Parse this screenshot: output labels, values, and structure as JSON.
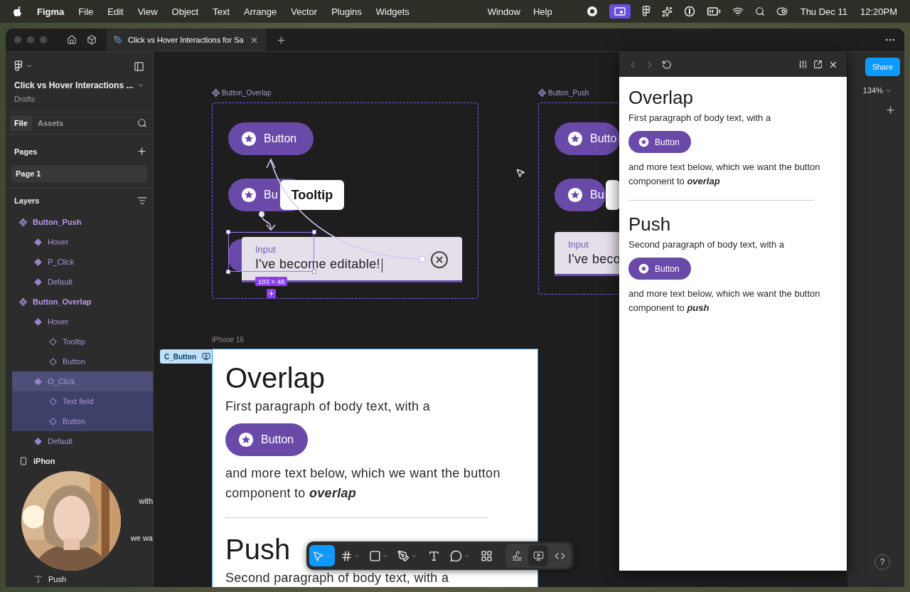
{
  "menubar": {
    "app": "Figma",
    "menus": [
      "File",
      "Edit",
      "View",
      "Object",
      "Text",
      "Arrange",
      "Vector",
      "Plugins",
      "Widgets"
    ],
    "right_menus": [
      "Window",
      "Help"
    ],
    "date": "Thu Dec 11",
    "time": "12:20PM"
  },
  "tabbar": {
    "tabs": [
      {
        "label": "Click vs Hover Interactions for Sa",
        "selected": true
      }
    ]
  },
  "sidebar": {
    "file_title": "Click vs Hover Interactions ...",
    "location": "Drafts",
    "tabs": [
      {
        "label": "File",
        "selected": true
      },
      {
        "label": "Assets",
        "selected": false
      }
    ],
    "pages_heading": "Pages",
    "pages": [
      {
        "label": "Page 1",
        "selected": true
      }
    ],
    "layers_heading": "Layers",
    "layers": [
      {
        "name": "Button_Push",
        "kind": "component",
        "selected": false,
        "children": [
          {
            "name": "Hover",
            "kind": "variant",
            "selected": false
          },
          {
            "name": "P_Click",
            "kind": "variant",
            "selected": false
          },
          {
            "name": "Default",
            "kind": "variant",
            "selected": false
          }
        ]
      },
      {
        "name": "Button_Overlap",
        "kind": "component",
        "selected": false,
        "children": [
          {
            "name": "Hover",
            "kind": "variant",
            "selected": false,
            "children": [
              {
                "name": "Tooltip",
                "kind": "instance",
                "selected": false
              },
              {
                "name": "Button",
                "kind": "instance",
                "selected": false
              }
            ]
          },
          {
            "name": "O_Click",
            "kind": "variant",
            "selected": true,
            "children": [
              {
                "name": "Text field",
                "kind": "instance",
                "selected": false
              },
              {
                "name": "Button",
                "kind": "instance",
                "selected": false
              }
            ]
          },
          {
            "name": "Default",
            "kind": "variant",
            "selected": false
          }
        ]
      },
      {
        "name": "iPhon",
        "kind": "frame",
        "selected": false,
        "children": [
          {
            "name": "with",
            "kind": "partial",
            "selected": false
          },
          {
            "name": "we wa",
            "kind": "partial",
            "selected": false
          },
          {
            "name": "Push",
            "kind": "text",
            "selected": false
          }
        ]
      }
    ]
  },
  "canvas": {
    "overlap_frame": {
      "label": "Button_Overlap",
      "button": "Button",
      "hover_button": "Bu",
      "tooltip": "Tooltip",
      "input_label": "Input",
      "input_value": "I've become editable!",
      "selection_size": "103 × 48"
    },
    "push_frame": {
      "label": "Button_Push",
      "button": "Butto",
      "hover_button": "Bu",
      "input_label": "Input",
      "input_value": "I've beco"
    },
    "phone": {
      "label": "iPhone 16",
      "tag": "C_Button",
      "sections": [
        {
          "heading": "Overlap",
          "first": "First paragraph of body text, with a",
          "button": "Button",
          "after": "and more text below, which we want the button component to **overlap**"
        },
        {
          "heading": "Push",
          "first": "Second paragraph of body text, with a"
        }
      ]
    },
    "toolbar": {
      "tools": [
        {
          "kind": "move",
          "selected": true
        },
        {
          "kind": "frame",
          "selected": false
        },
        {
          "kind": "shape",
          "selected": false
        },
        {
          "kind": "pen",
          "selected": false
        },
        {
          "kind": "text",
          "selected": false
        },
        {
          "kind": "comment",
          "selected": false
        },
        {
          "kind": "assets",
          "selected": false
        }
      ],
      "modes": [
        {
          "kind": "draw",
          "selected": false
        },
        {
          "kind": "design",
          "selected": true
        },
        {
          "kind": "dev",
          "selected": false
        }
      ]
    }
  },
  "preview": {
    "sections": [
      {
        "heading": "Overlap",
        "first": "First paragraph of body text, with a",
        "button": "Button",
        "after": "and more text below, which we want the button component to **overlap**"
      },
      {
        "heading": "Push",
        "first": "Second paragraph of body text, with a",
        "button": "Button",
        "after": "and more text below, which we want the button component to **push**"
      }
    ]
  },
  "right_panel": {
    "share": "Share",
    "zoom": "134%",
    "help": "?"
  }
}
